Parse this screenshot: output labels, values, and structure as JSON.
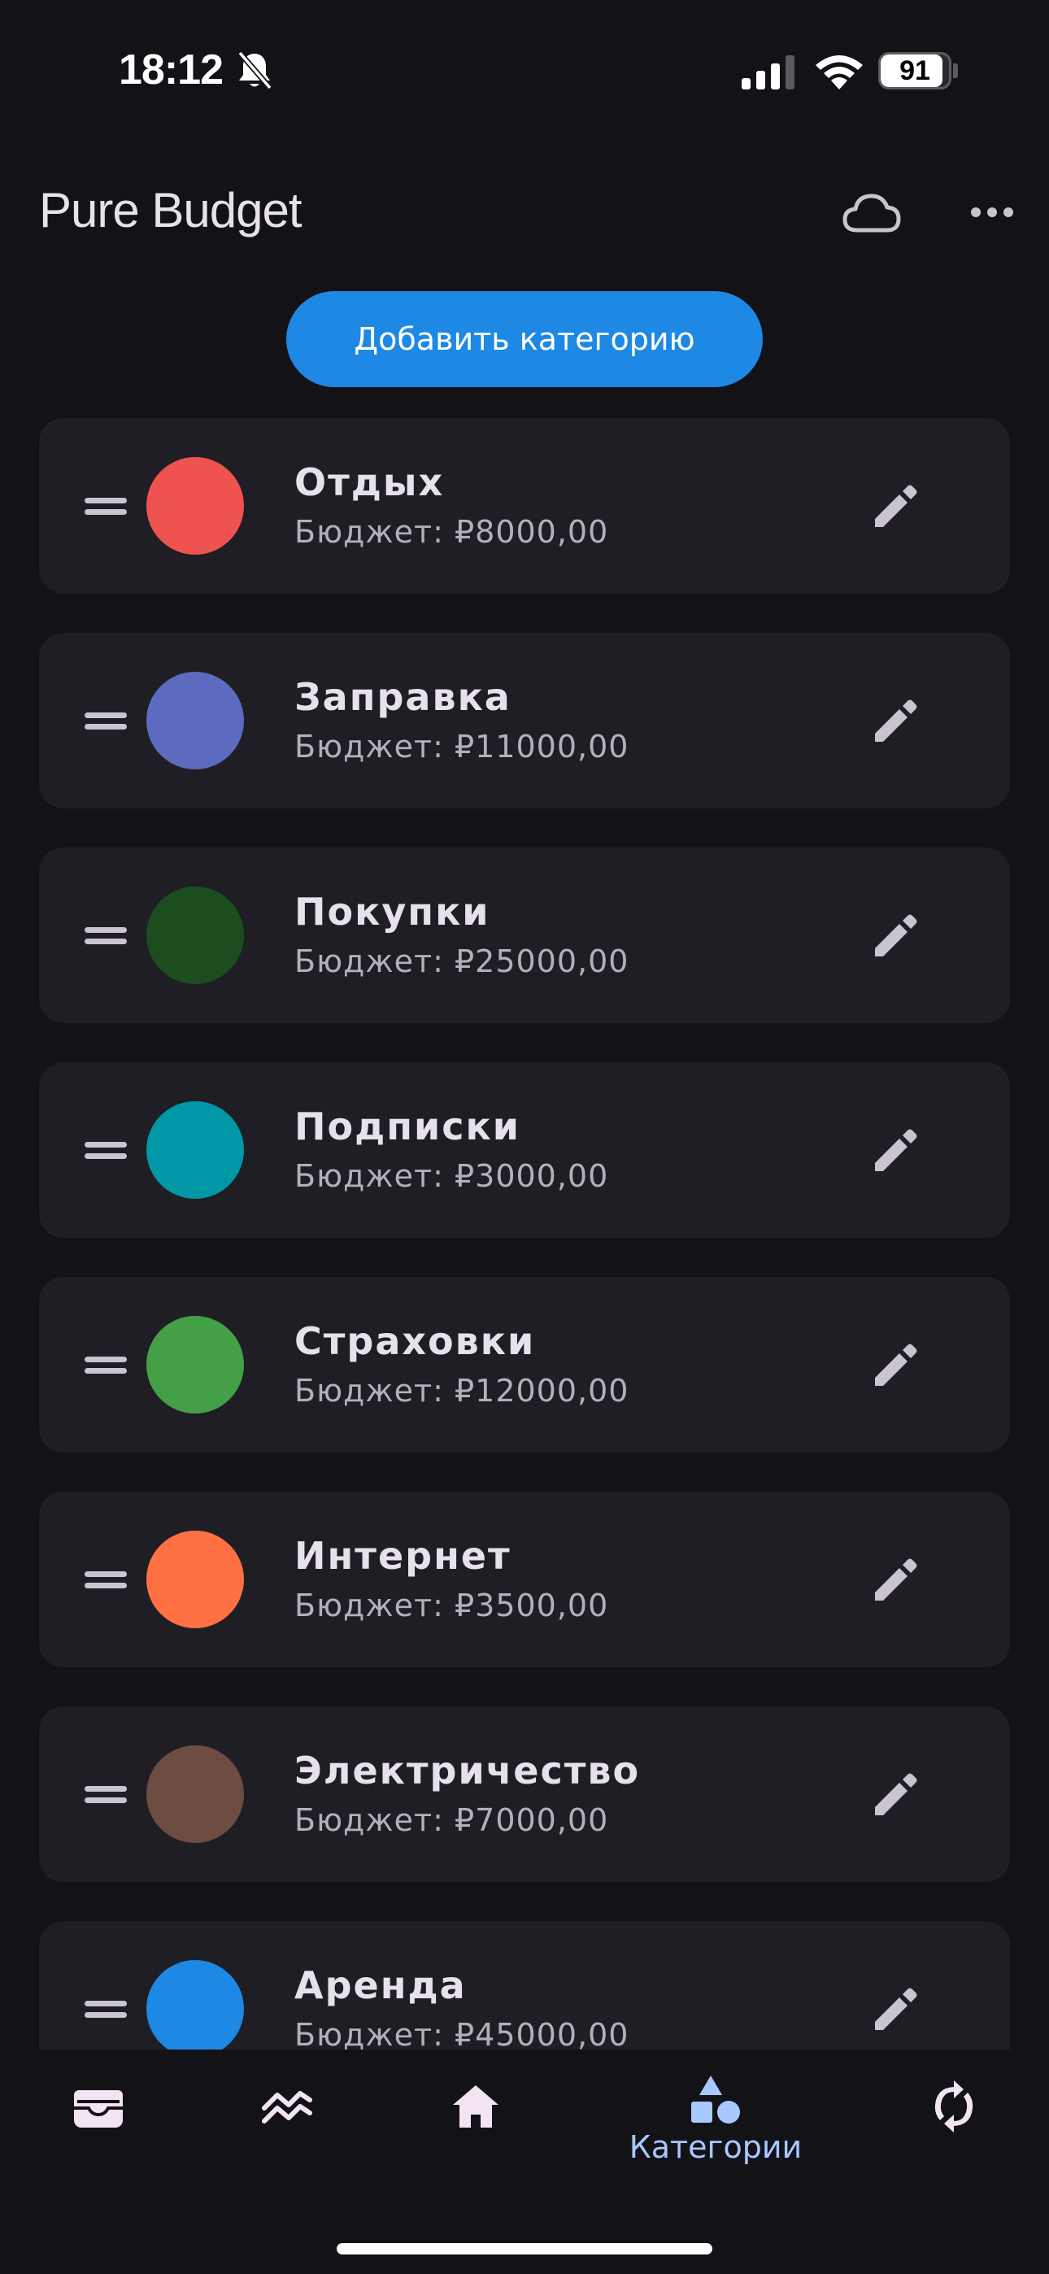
{
  "status_bar": {
    "time": "18:12",
    "battery_level": "91",
    "battery_fraction": 0.91,
    "icons": [
      "bell-slash-icon",
      "cellular-signal-icon",
      "wifi-icon",
      "battery-icon"
    ]
  },
  "app_bar": {
    "title": "Pure Budget",
    "icons": [
      "cloud-icon",
      "more-horizontal-icon"
    ]
  },
  "add_category_label": "Добавить категорию",
  "categories": [
    {
      "name": "Отдых",
      "budget": "Бюджет: ₽8000,00",
      "color": "#ef5350"
    },
    {
      "name": "Заправка",
      "budget": "Бюджет: ₽11000,00",
      "color": "#5c6bc0"
    },
    {
      "name": "Покупки",
      "budget": "Бюджет: ₽25000,00",
      "color": "#1b4d1f"
    },
    {
      "name": "Подписки",
      "budget": "Бюджет: ₽3000,00",
      "color": "#0097a7"
    },
    {
      "name": "Страховки",
      "budget": "Бюджет: ₽12000,00",
      "color": "#43a047"
    },
    {
      "name": "Интернет",
      "budget": "Бюджет: ₽3500,00",
      "color": "#ff7043"
    },
    {
      "name": "Электричество",
      "budget": "Бюджет: ₽7000,00",
      "color": "#6d4c41"
    },
    {
      "name": "Аренда",
      "budget": "Бюджет: ₽45000,00",
      "color": "#1e88e5"
    }
  ],
  "bottom_nav": {
    "items": [
      {
        "icon": "wallet-icon",
        "label": ""
      },
      {
        "icon": "trending-icon",
        "label": ""
      },
      {
        "icon": "home-icon",
        "label": ""
      },
      {
        "icon": "categories-icon",
        "label": "Категории",
        "selected": true
      },
      {
        "icon": "sync-icon",
        "label": ""
      }
    ]
  },
  "colors": {
    "background": "#131217",
    "card": "#1f1e24",
    "accent": "#1e88e5",
    "nav_selected": "#a8c8ff"
  }
}
